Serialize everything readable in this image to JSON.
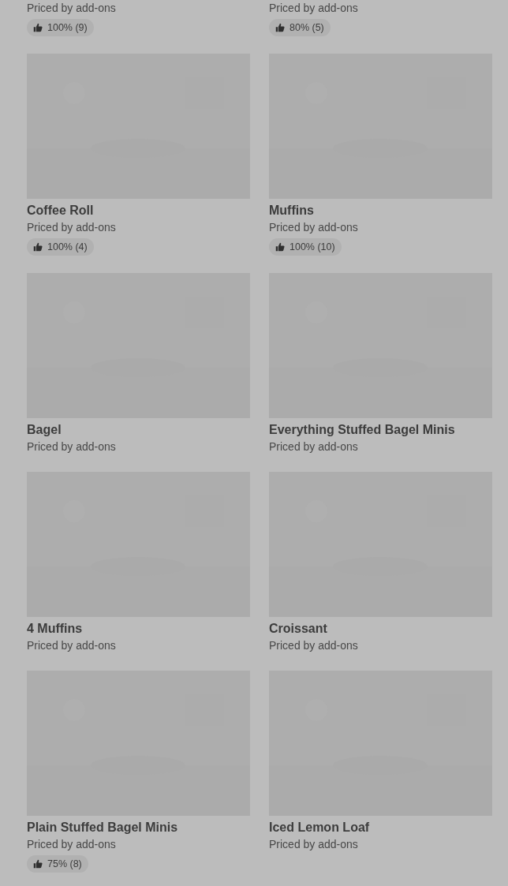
{
  "partial_row": [
    {
      "subtitle": "Priced by add-ons",
      "rating": "100% (9)"
    },
    {
      "subtitle": "Priced by add-ons",
      "rating": "80% (5)"
    }
  ],
  "items": [
    {
      "kind": "picture",
      "name": "Coffee Roll",
      "subtitle": "Priced by add-ons",
      "rating": "100% (4)"
    },
    {
      "kind": "picture",
      "name": "Muffins",
      "subtitle": "Priced by add-ons",
      "rating": "100% (10)"
    },
    {
      "kind": "picture",
      "name": "Bagel",
      "subtitle": "Priced by add-ons"
    },
    {
      "kind": "picture",
      "name": "Everything Stuffed Bagel Minis",
      "subtitle": "Priced by add-ons"
    },
    {
      "kind": "picture",
      "name": "4 Muffins",
      "subtitle": "Priced by add-ons"
    },
    {
      "kind": "picture",
      "name": "Croissant",
      "subtitle": "Priced by add-ons"
    },
    {
      "kind": "picture",
      "name": "Plain Stuffed Bagel Minis",
      "subtitle": "Priced by add-ons",
      "rating": "75% (8)"
    },
    {
      "kind": "picture",
      "name": "Iced Lemon Loaf",
      "subtitle": "Priced by add-ons"
    }
  ]
}
